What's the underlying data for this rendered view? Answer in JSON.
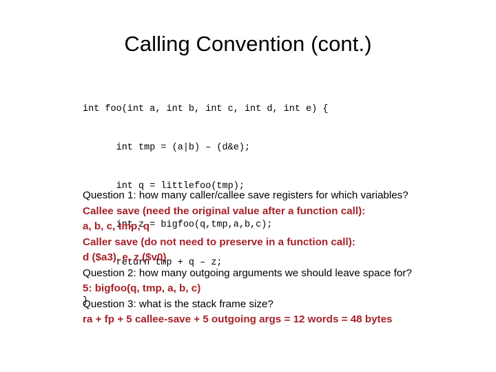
{
  "slide": {
    "title": "Calling Convention (cont.)",
    "code_lines": [
      "int foo(int a, int b, int c, int d, int e) {",
      "      int tmp = (a|b) – (d&e);",
      "      int q = littlefoo(tmp);",
      "      int z = bigfoo(q,tmp,a,b,c);",
      "      return tmp + q – z;",
      "}"
    ],
    "qa_lines": [
      {
        "text": "Question 1: how many caller/callee save registers for which variables?",
        "kind": "question",
        "indent": 0
      },
      {
        "text": "Callee save (need the original value after a function call):",
        "kind": "answer",
        "indent": 1
      },
      {
        "text": "a, b, c, tmp, q",
        "kind": "answer",
        "indent": 3
      },
      {
        "text": "Caller save (do not need to preserve in a function call):",
        "kind": "answer",
        "indent": 4
      },
      {
        "text": "d ($a3), e, z ($v0)",
        "kind": "answer",
        "indent": 5
      },
      {
        "text": "Question 2: how many outgoing arguments we should leave space for?",
        "kind": "question",
        "indent": 0
      },
      {
        "text": "5: bigfoo(q, tmp, a, b, c)",
        "kind": "answer",
        "indent": 6
      },
      {
        "text": "Question 3: what is the stack frame size?",
        "kind": "question",
        "indent": 0
      },
      {
        "text": "ra + fp + 5 callee-save + 5 outgoing args = 12 words = 48 bytes",
        "kind": "answer",
        "indent": 7
      }
    ]
  },
  "colors": {
    "background": "#FFFFFF",
    "text": "#000000",
    "answer_red": "#A52128"
  }
}
